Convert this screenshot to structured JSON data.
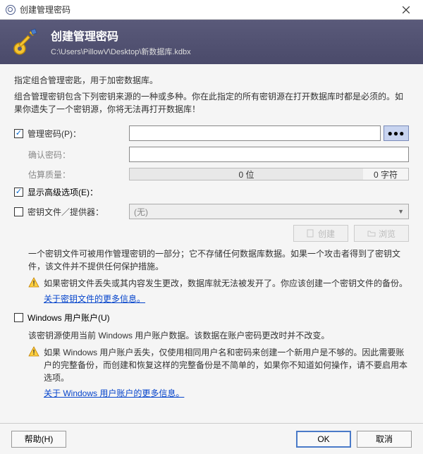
{
  "titlebar": {
    "title": "创建管理密码"
  },
  "header": {
    "title": "创建管理密码",
    "path": "C:\\Users\\PillowV\\Desktop\\新数据库.kdbx"
  },
  "intro": {
    "line1": "指定组合管理密匙，用于加密数据库。",
    "line2": "组合管理密钥包含下列密钥来源的一种或多种。你在此指定的所有密钥源在打开数据库时都是必须的。如果你遗失了一个密钥源，你将无法再打开数据库！"
  },
  "password": {
    "label": "管理密码(P)：",
    "confirm_label": "确认密码：",
    "quality_label": "估算质量：",
    "quality_bits": "0 位",
    "quality_chars": "0 字符",
    "eye": "●●●"
  },
  "advanced": {
    "label": "显示高级选项(E)："
  },
  "keyfile": {
    "label": "密钥文件／提供器：",
    "dropdown_value": "(无)",
    "create_btn": "创建",
    "browse_btn": "浏览",
    "desc": "一个密钥文件可被用作管理密钥的一部分；它不存储任何数据库数据。如果一个攻击者得到了密钥文件，该文件并不提供任何保护措施。",
    "warn": "如果密钥文件丢失或其内容发生更改，数据库就无法被发开了。你应该创建一个密钥文件的备份。",
    "link": "关于密钥文件的更多信息。"
  },
  "winaccount": {
    "label": "Windows 用户账户(U)",
    "desc": "该密钥源使用当前 Windows 用户账户数据。该数据在账户密码更改时并不改变。",
    "warn": "如果 Windows 用户账户丢失，仅使用相同用户名和密码来创建一个新用户是不够的。因此需要账户的完整备份，而创建和恢复这样的完整备份是不简单的，如果你不知道如何操作，请不要启用本选项。",
    "link": "关于 Windows 用户账户的更多信息。"
  },
  "footer": {
    "help": "帮助(H)",
    "ok": "OK",
    "cancel": "取消"
  }
}
